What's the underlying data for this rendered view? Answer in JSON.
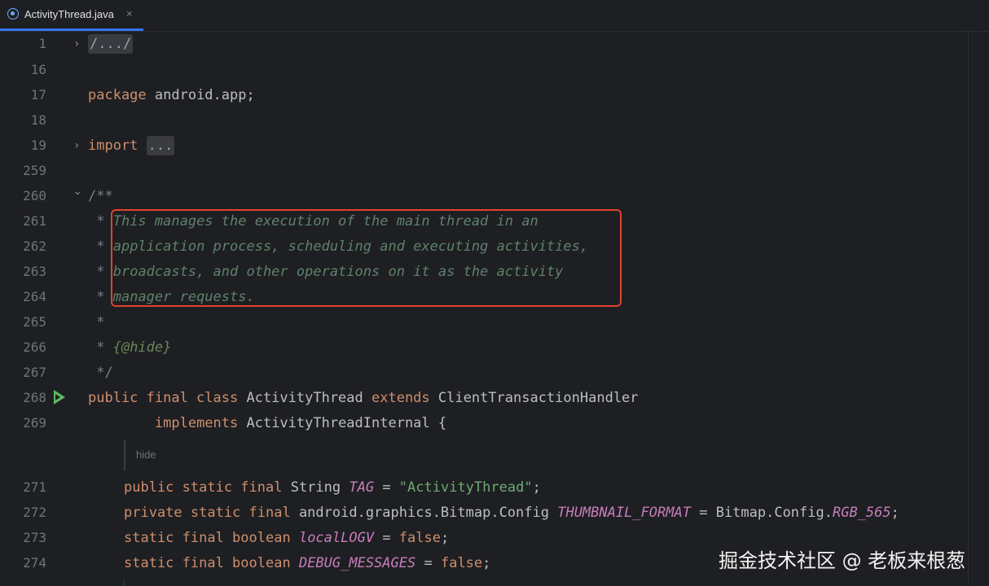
{
  "tab": {
    "label": "ActivityThread.java",
    "close": "×",
    "icon": "java-class-icon"
  },
  "lines": [
    {
      "num": "1",
      "text": "/.../"
    },
    {
      "num": "16",
      "text": ""
    },
    {
      "num": "17",
      "kw": "package",
      "rest": " android.app;"
    },
    {
      "num": "18",
      "text": ""
    },
    {
      "num": "19",
      "kw": "import",
      "folded": "..."
    },
    {
      "num": "259",
      "text": ""
    },
    {
      "num": "260",
      "text": "/**"
    },
    {
      "num": "261",
      "star": " * ",
      "doc": "This manages the execution of the main thread in an"
    },
    {
      "num": "262",
      "star": " * ",
      "doc": "application process, scheduling and executing activities,"
    },
    {
      "num": "263",
      "star": " * ",
      "doc": "broadcasts, and other operations on it as the activity"
    },
    {
      "num": "264",
      "star": " * ",
      "doc": "manager requests."
    },
    {
      "num": "265",
      "text": " *"
    },
    {
      "num": "266",
      "star": " * ",
      "tag": "{@hide}"
    },
    {
      "num": "267",
      "text": " */"
    },
    {
      "num": "268"
    },
    {
      "num": "269"
    },
    {
      "num": "271"
    },
    {
      "num": "272"
    },
    {
      "num": "273"
    },
    {
      "num": "274"
    }
  ],
  "code": {
    "l268": {
      "kw1": "public final class",
      "name": " ActivityThread ",
      "kw2": "extends",
      "rest": " ClientTransactionHandler"
    },
    "l269": {
      "indent": "        ",
      "kw": "implements",
      "rest": " ActivityThreadInternal {"
    },
    "l271": {
      "kw": "public static final",
      "type": " String ",
      "const": "TAG",
      "eq": " = ",
      "str": "\"ActivityThread\"",
      "end": ";"
    },
    "l272": {
      "kw": "private static final",
      "type": " android.graphics.Bitmap.Config ",
      "const": "THUMBNAIL_FORMAT",
      "eq": " = Bitmap.Config.",
      "const2": "RGB_565",
      "end": ";"
    },
    "l273": {
      "kw": "static final boolean",
      "const": "localLOGV",
      "eq": " = ",
      "kw2": "false",
      "end": ";"
    },
    "l274": {
      "kw": "static final boolean",
      "const": "DEBUG_MESSAGES",
      "eq": " = ",
      "kw2": "false",
      "end": ";"
    }
  },
  "hint": {
    "label": "hide"
  },
  "watermark": "掘金技术社区 @ 老板来根葱",
  "colors": {
    "background": "#1e1f22",
    "keyword": "#cf8e6d",
    "doc_comment": "#5f826b",
    "string": "#6aab73",
    "constant": "#c77dbb",
    "highlight_border": "#e0432f",
    "tab_accent": "#3574f0",
    "run_icon": "#5fb865"
  }
}
